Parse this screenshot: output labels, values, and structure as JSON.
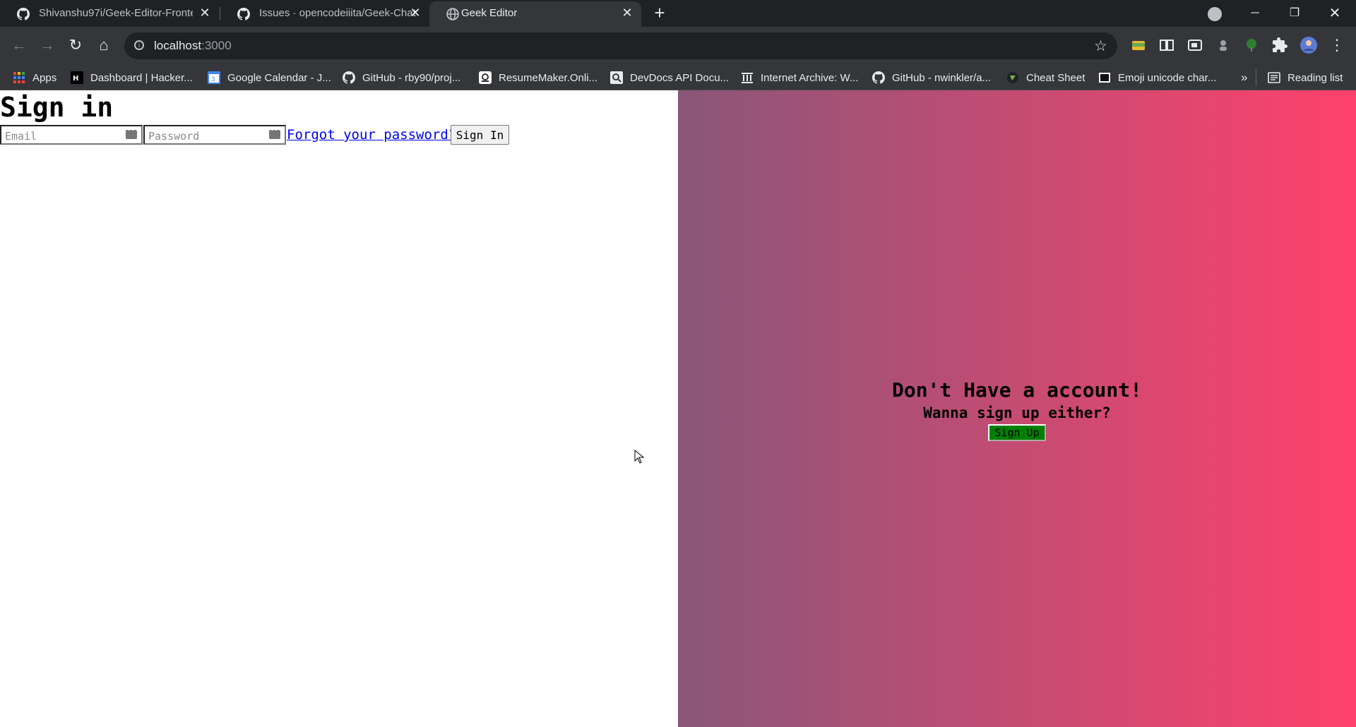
{
  "browser": {
    "tabs": [
      {
        "title": "Shivanshu97i/Geek-Editor-Fronte",
        "icon": "github-icon",
        "active": false
      },
      {
        "title": "Issues · opencodeiiita/Geek-Chat",
        "icon": "github-icon",
        "active": false
      },
      {
        "title": "Geek Editor",
        "icon": "globe-icon",
        "active": true
      }
    ],
    "address": {
      "host": "localhost",
      "port": ":3000"
    },
    "bookmarks": [
      {
        "label": "Apps",
        "icon": "apps-grid-icon"
      },
      {
        "label": "Dashboard | Hacker...",
        "icon": "hackerrank-icon"
      },
      {
        "label": "Google Calendar - J...",
        "icon": "calendar-icon"
      },
      {
        "label": "GitHub - rby90/proj...",
        "icon": "github-icon"
      },
      {
        "label": "ResumeMaker.Onli...",
        "icon": "resume-icon"
      },
      {
        "label": "DevDocs API Docu...",
        "icon": "devdocs-icon"
      },
      {
        "label": "Internet Archive: W...",
        "icon": "archive-icon"
      },
      {
        "label": "GitHub - nwinkler/a...",
        "icon": "github-icon"
      },
      {
        "label": "Cheat Sheet",
        "icon": "cheatsheet-icon"
      },
      {
        "label": "Emoji unicode char...",
        "icon": "emoji-icon"
      }
    ],
    "bookmarks_overflow": "»",
    "reading_list": "Reading list",
    "colors": {
      "frame": "#202124",
      "toolbar": "#35363a",
      "text": "#e8eaed"
    }
  },
  "page": {
    "signin": {
      "title": "Sign in",
      "email_placeholder": "Email",
      "password_placeholder": "Password",
      "forgot_link": "Forgot your password?",
      "submit_label": "Sign In"
    },
    "signup_panel": {
      "heading": "Don't Have a account!",
      "subheading": "Wanna sign up either?",
      "button_label": "Sign Up",
      "gradient_start": "#8a5679",
      "gradient_end": "#ff416c",
      "button_color": "#008000"
    }
  }
}
